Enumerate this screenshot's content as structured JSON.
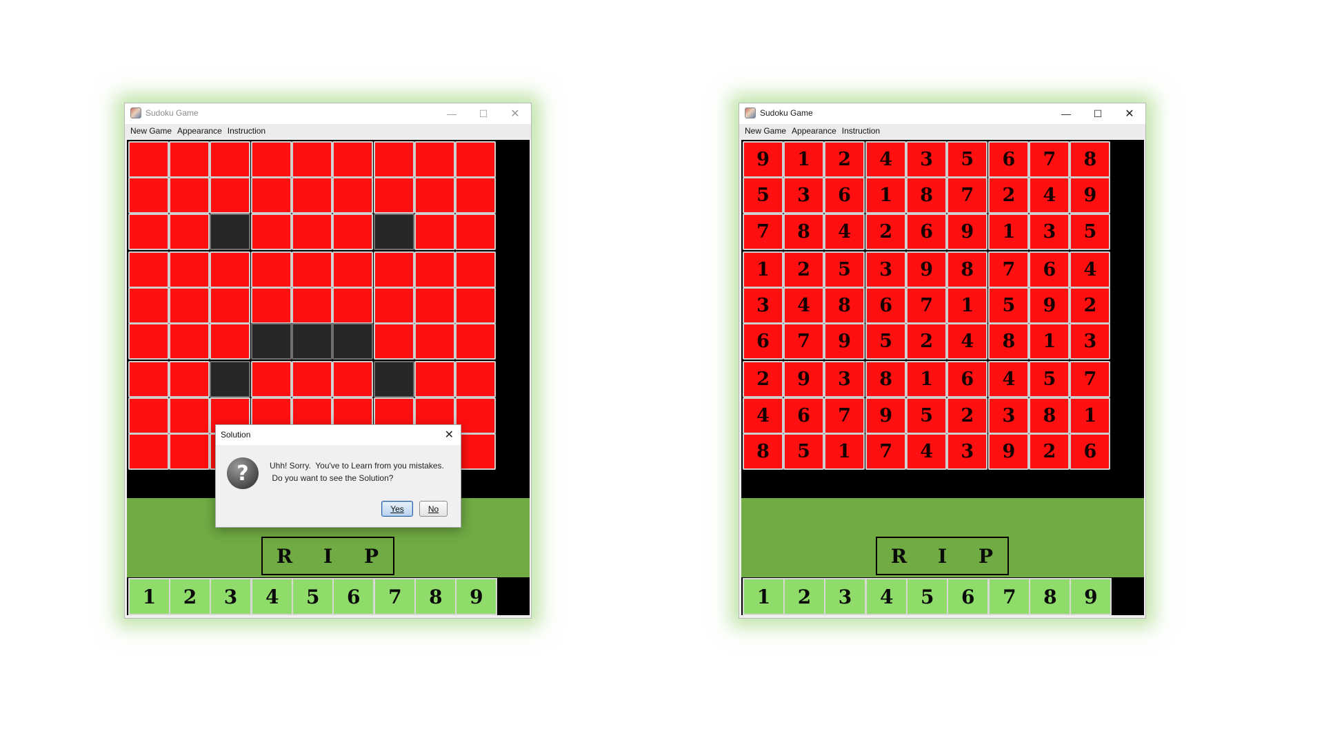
{
  "windows": [
    {
      "title": "Sudoku Game",
      "menu": [
        "New Game",
        "Appearance",
        "Instruction"
      ],
      "dark_cells": [
        [
          2,
          2
        ],
        [
          2,
          6
        ],
        [
          5,
          3
        ],
        [
          5,
          4
        ],
        [
          5,
          5
        ],
        [
          6,
          2
        ],
        [
          6,
          6
        ]
      ],
      "grid": [
        [
          "",
          "",
          "",
          "",
          "",
          "",
          "",
          "",
          ""
        ],
        [
          "",
          "",
          "",
          "",
          "",
          "",
          "",
          "",
          ""
        ],
        [
          "",
          "",
          "",
          "",
          "",
          "",
          "",
          "",
          ""
        ],
        [
          "",
          "",
          "",
          "",
          "",
          "",
          "",
          "",
          ""
        ],
        [
          "",
          "",
          "",
          "",
          "",
          "",
          "",
          "",
          ""
        ],
        [
          "",
          "",
          "",
          "",
          "",
          "",
          "",
          "",
          ""
        ],
        [
          "",
          "",
          "",
          "",
          "",
          "",
          "",
          "",
          ""
        ],
        [
          "",
          "",
          "",
          "",
          "",
          "",
          "",
          "",
          ""
        ],
        [
          "",
          "",
          "",
          "",
          "",
          "",
          "",
          "",
          ""
        ]
      ],
      "rip": [
        "R",
        "I",
        "P"
      ],
      "number_buttons": [
        "1",
        "2",
        "3",
        "4",
        "5",
        "6",
        "7",
        "8",
        "9"
      ],
      "dialog": {
        "title": "Solution",
        "message_line1": "Uhh! Sorry.  You've to Learn from you mistakes.",
        "message_line2": " Do you want to see the Solution?",
        "yes_label": "Yes",
        "no_label": "No"
      }
    },
    {
      "title": "Sudoku Game",
      "menu": [
        "New Game",
        "Appearance",
        "Instruction"
      ],
      "dark_cells": [],
      "grid": [
        [
          "9",
          "1",
          "2",
          "4",
          "3",
          "5",
          "6",
          "7",
          "8"
        ],
        [
          "5",
          "3",
          "6",
          "1",
          "8",
          "7",
          "2",
          "4",
          "9"
        ],
        [
          "7",
          "8",
          "4",
          "2",
          "6",
          "9",
          "1",
          "3",
          "5"
        ],
        [
          "1",
          "2",
          "5",
          "3",
          "9",
          "8",
          "7",
          "6",
          "4"
        ],
        [
          "3",
          "4",
          "8",
          "6",
          "7",
          "1",
          "5",
          "9",
          "2"
        ],
        [
          "6",
          "7",
          "9",
          "5",
          "2",
          "4",
          "8",
          "1",
          "3"
        ],
        [
          "2",
          "9",
          "3",
          "8",
          "1",
          "6",
          "4",
          "5",
          "7"
        ],
        [
          "4",
          "6",
          "7",
          "9",
          "5",
          "2",
          "3",
          "8",
          "1"
        ],
        [
          "8",
          "5",
          "1",
          "7",
          "4",
          "3",
          "9",
          "2",
          "6"
        ]
      ],
      "rip": [
        "R",
        "I",
        "P"
      ],
      "number_buttons": [
        "1",
        "2",
        "3",
        "4",
        "5",
        "6",
        "7",
        "8",
        "9"
      ]
    }
  ],
  "colors": {
    "cell_red": "#ff0f0f",
    "cell_dark": "#262626",
    "panel_green": "#70ab43",
    "button_green": "#8fdc6a",
    "window_glow": "#8ace62"
  },
  "icons": {
    "app": "sudoku-app-icon",
    "minimize": "minimize-icon",
    "maximize": "maximize-icon",
    "close": "close-icon",
    "question": "question-icon"
  }
}
